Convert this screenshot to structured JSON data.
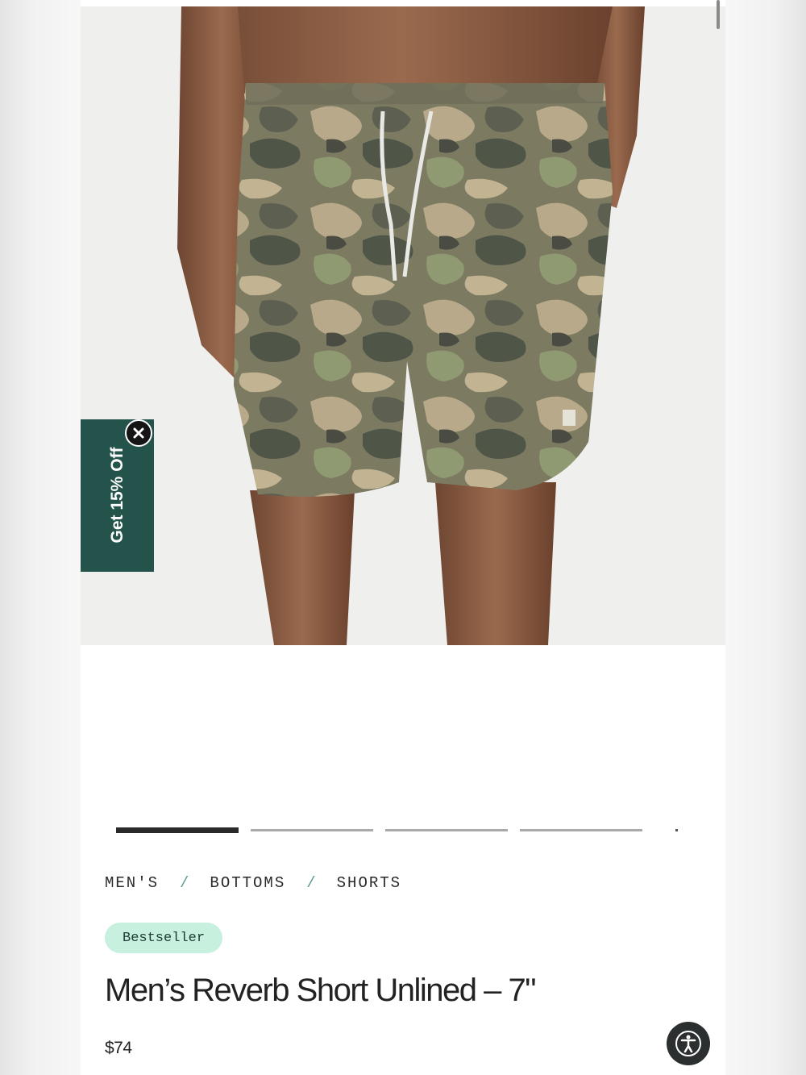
{
  "promo": {
    "label": "Get 15% Off",
    "close_icon": "close-icon"
  },
  "gallery": {
    "image_alt": "Men's camo print shorts worn by model",
    "image_count": 4,
    "active_index": 0
  },
  "breadcrumb": {
    "items": [
      "MEN'S",
      "BOTTOMS",
      "SHORTS"
    ],
    "separator": "/"
  },
  "badge": "Bestseller",
  "product": {
    "title": "Men’s Reverb Short Unlined – 7\"",
    "price": "$74"
  },
  "accessibility": {
    "icon": "accessibility-icon"
  },
  "colors": {
    "promo_bg": "#24534b",
    "badge_bg": "#c7f0df",
    "breadcrumb_sep": "#5f9c92"
  }
}
